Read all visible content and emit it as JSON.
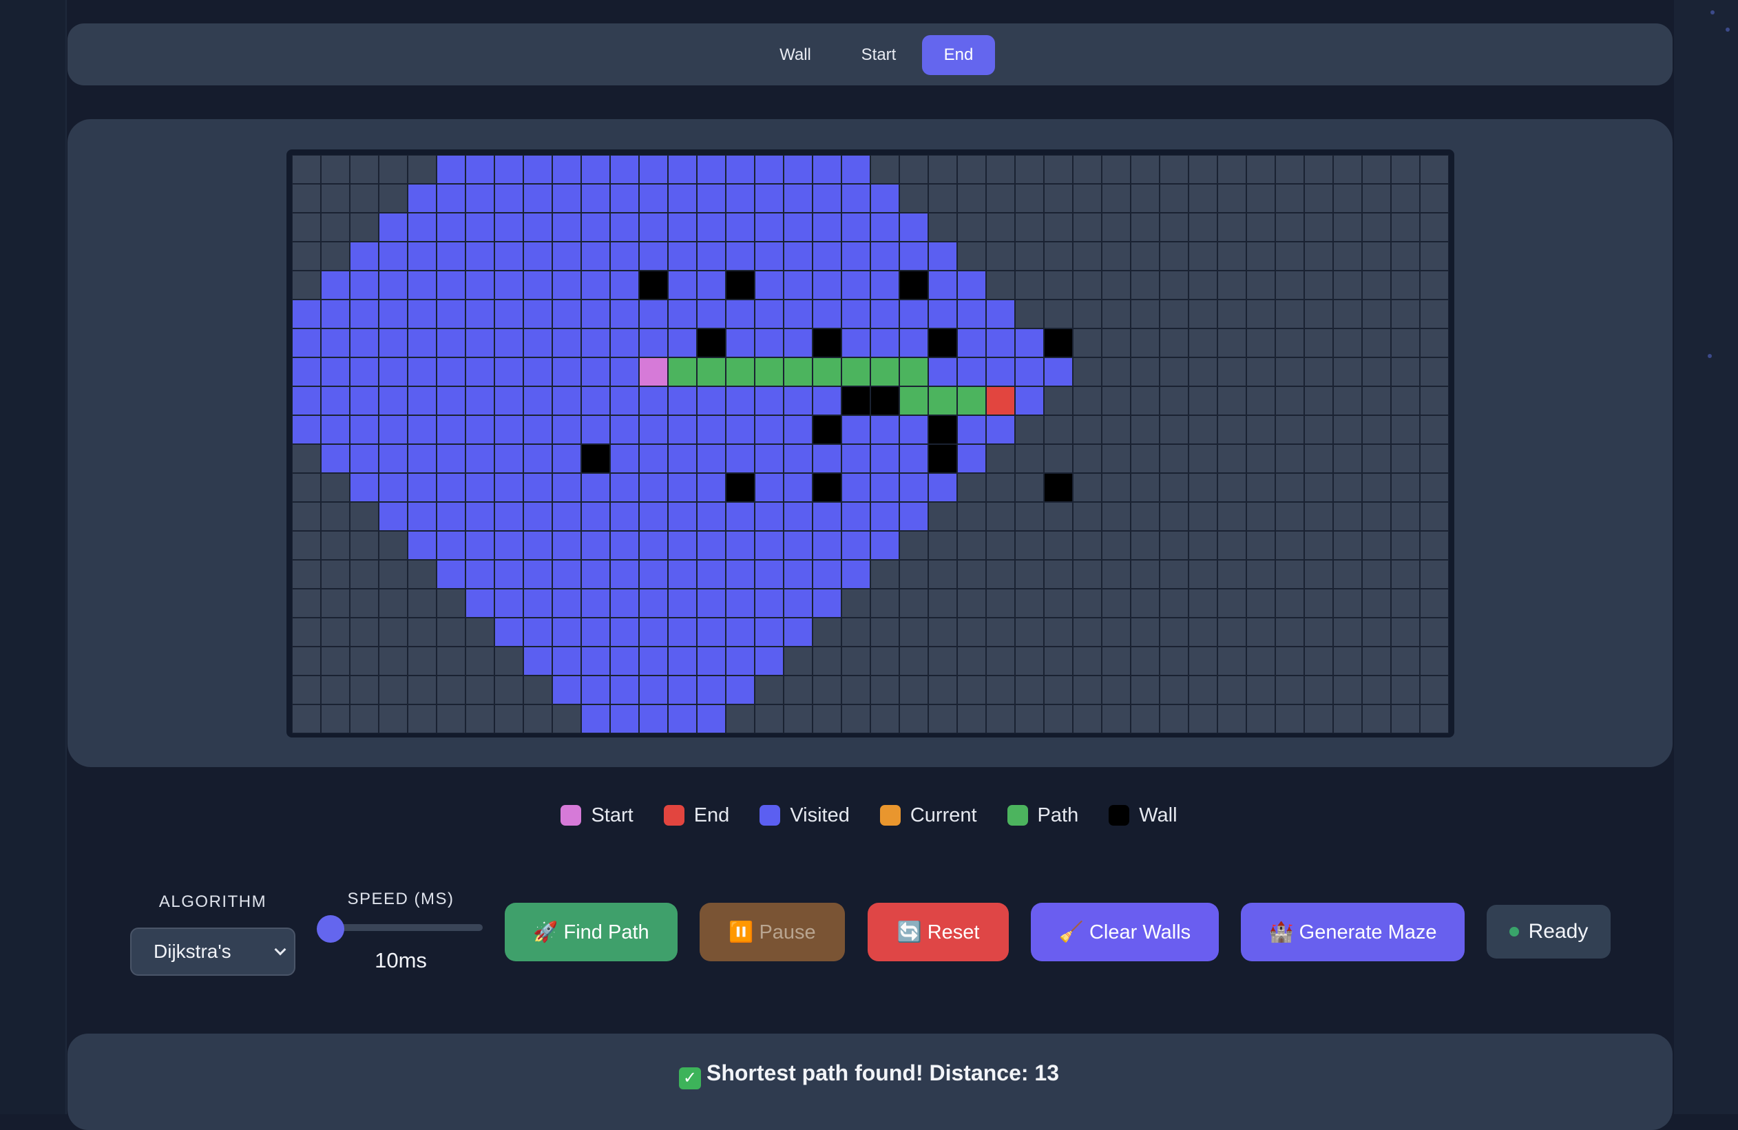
{
  "modes": {
    "wall": "Wall",
    "start": "Start",
    "end": "End",
    "active": "end"
  },
  "grid": {
    "cols": 40,
    "rows": 20,
    "visited_spans": [
      [
        5,
        19
      ],
      [
        4,
        20
      ],
      [
        3,
        21
      ],
      [
        2,
        22
      ],
      [
        1,
        23
      ],
      [
        0,
        24
      ],
      [
        0,
        25
      ],
      [
        0,
        26
      ],
      [
        0,
        25
      ],
      [
        0,
        24
      ],
      [
        1,
        23
      ],
      [
        2,
        22
      ],
      [
        3,
        21
      ],
      [
        4,
        20
      ],
      [
        5,
        19
      ],
      [
        6,
        18
      ],
      [
        7,
        17
      ],
      [
        8,
        16
      ],
      [
        9,
        15
      ],
      [
        10,
        14
      ]
    ],
    "walls": [
      [
        4,
        12
      ],
      [
        4,
        15
      ],
      [
        4,
        21
      ],
      [
        6,
        14
      ],
      [
        6,
        18
      ],
      [
        6,
        22
      ],
      [
        6,
        26
      ],
      [
        8,
        19
      ],
      [
        8,
        20
      ],
      [
        9,
        18
      ],
      [
        9,
        22
      ],
      [
        10,
        10
      ],
      [
        10,
        22
      ],
      [
        11,
        15
      ],
      [
        11,
        18
      ],
      [
        11,
        26
      ]
    ],
    "path": [
      [
        7,
        13
      ],
      [
        7,
        14
      ],
      [
        7,
        15
      ],
      [
        7,
        16
      ],
      [
        7,
        17
      ],
      [
        7,
        18
      ],
      [
        7,
        19
      ],
      [
        7,
        20
      ],
      [
        7,
        21
      ],
      [
        8,
        21
      ],
      [
        8,
        22
      ],
      [
        8,
        23
      ]
    ],
    "start": [
      7,
      12
    ],
    "end": [
      8,
      24
    ]
  },
  "legend": [
    {
      "label": "Start",
      "color": "#d67ad8"
    },
    {
      "label": "End",
      "color": "#e2453f"
    },
    {
      "label": "Visited",
      "color": "#5b5ff1"
    },
    {
      "label": "Current",
      "color": "#e9962e"
    },
    {
      "label": "Path",
      "color": "#4cb45e"
    },
    {
      "label": "Wall",
      "color": "#000000"
    }
  ],
  "controls": {
    "algorithm_label": "ALGORITHM",
    "algorithm_value": "Dijkstra's",
    "speed_label": "SPEED (MS)",
    "speed_value": "10ms",
    "find_path": "🚀 Find Path",
    "pause": "⏸️ Pause",
    "reset": "🔄 Reset",
    "clear_walls": "🧹 Clear Walls",
    "generate_maze": "🏰 Generate Maze",
    "status": "Ready"
  },
  "result": {
    "icon": "✓",
    "text": "Shortest path found! Distance: 13"
  }
}
